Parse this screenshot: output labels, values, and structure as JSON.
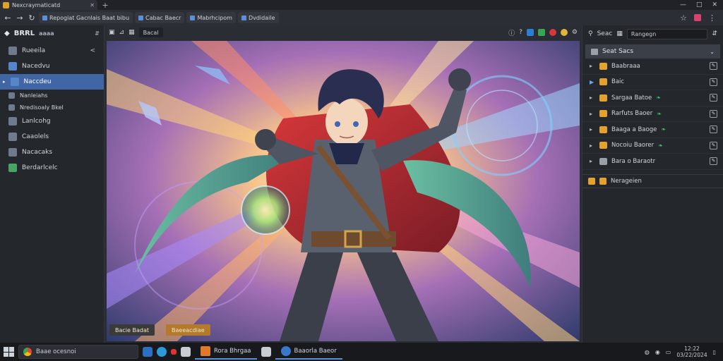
{
  "browser": {
    "tab_title": "Nexcraymaticatd",
    "toolbar_bookmarks": [
      "Repogiat Gacnlais Baat bibu",
      "Cabac Baecr",
      "Mabrhcipom",
      "Dvdidaile"
    ],
    "window_controls": [
      "—",
      "□",
      "✕"
    ]
  },
  "sidebar": {
    "title": "BRRL",
    "subtitle": "aaaa",
    "items": [
      {
        "label": "Rueeila",
        "icon": "image-icon"
      },
      {
        "label": "Nacedvu",
        "icon": "picture-icon"
      },
      {
        "label": "Naccdeu",
        "icon": "document-icon",
        "active": true
      },
      {
        "label": "Nanleiahs",
        "icon": "file-icon",
        "small": true
      },
      {
        "label": "Nredisoaly Bkel",
        "icon": "file-icon",
        "small": true
      },
      {
        "label": "Lanlcohg",
        "icon": "file-icon"
      },
      {
        "label": "Caaolels",
        "icon": "gallery-icon"
      },
      {
        "label": "Nacacaks",
        "icon": "gallery-icon"
      },
      {
        "label": "Berdarlcelc",
        "icon": "sheet-icon"
      }
    ]
  },
  "viewer": {
    "field": "Bacal",
    "chip_left": "Bacie Badat",
    "chip_right": "Baeeacdiae"
  },
  "right_panel": {
    "header_label": "Seac",
    "search_value": "Rangegn",
    "group_label": "Seat Sacs",
    "rows": [
      {
        "label": "Baabraaa",
        "leaf": false
      },
      {
        "label": "Baic",
        "leaf": false,
        "selected": true
      },
      {
        "label": "Sargaa Batoe",
        "leaf": true
      },
      {
        "label": "Rarfuts Baoer",
        "leaf": true
      },
      {
        "label": "Baaga a Baoge",
        "leaf": true
      },
      {
        "label": "Nocoiu Baorer",
        "leaf": true
      },
      {
        "label": "Bara o Baraotr",
        "leaf": false
      }
    ],
    "footer_label": "Nerageien"
  },
  "taskbar": {
    "search_text": "Baae ocesnoi",
    "apps": [
      {
        "label": "Rora Bhrgaa"
      },
      {
        "label": "Baaorla Baeor"
      }
    ],
    "clock_line1": "12:22",
    "clock_line2": "03/22/2024"
  },
  "colors": {
    "accent": "#4066a6",
    "folder": "#e3a22e",
    "leaf_ok": "#43c064"
  }
}
